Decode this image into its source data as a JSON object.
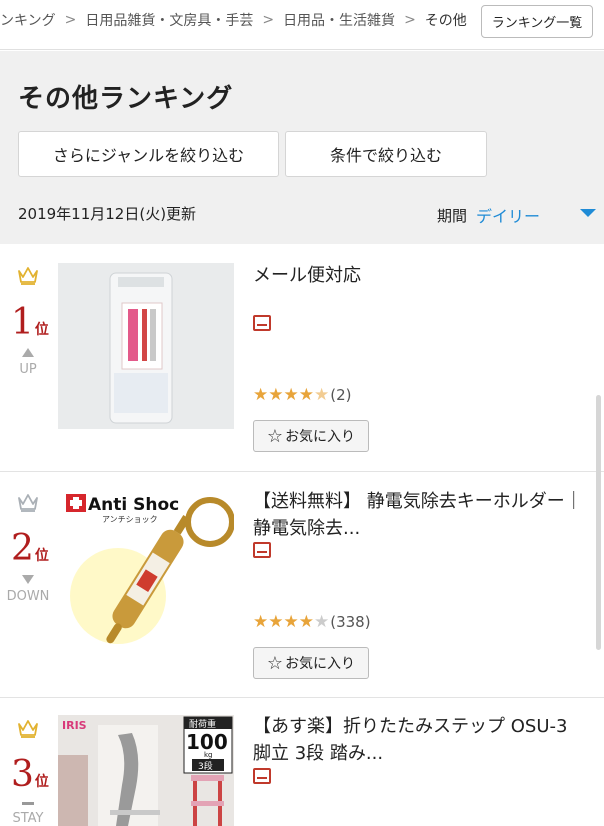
{
  "breadcrumb": {
    "items": [
      "ンキング",
      "日用品雑貨・文房具・手芸",
      "日用品・生活雑貨",
      "その他"
    ],
    "separator": ">"
  },
  "header": {
    "ranking_list_button": "ランキング一覧",
    "title": "その他ランキング",
    "genre_filter_button": "さらにジャンルを絞り込む",
    "condition_filter_button": "条件で絞り込む",
    "updated": "2019年11月12日(火)更新",
    "period_label": "期間",
    "period_value": "デイリー"
  },
  "colors": {
    "accent": "#1f8bd6",
    "rank": "#b01e1e",
    "star": "#e8a43a",
    "shop": "#c0392b"
  },
  "items": [
    {
      "rank": "1",
      "rank_unit": "位",
      "trend": "UP",
      "trend_icon": "up-arrow-icon",
      "name": "メール便対応",
      "stars": "★★★★",
      "half_star": "★",
      "empty_stars": "",
      "review_count": "(2)",
      "favorite_label": "お気に入り",
      "crown": "gold-crown-icon",
      "image": "clear-liquid-packet-image"
    },
    {
      "rank": "2",
      "rank_unit": "位",
      "trend": "DOWN",
      "trend_icon": "down-arrow-icon",
      "name": "【送料無料】 静電気除去キーホルダー｜静電気除去...",
      "stars": "★★★★",
      "half_star": "",
      "empty_stars": "★",
      "review_count": "(338)",
      "favorite_label": "お気に入り",
      "crown": "silver-crown-icon",
      "image": "anti-shock-keyholder-image",
      "image_text": {
        "brand": "Anti Shoc",
        "sub": "アンチショック"
      }
    },
    {
      "rank": "3",
      "rank_unit": "位",
      "trend": "STAY",
      "trend_icon": "dash-icon",
      "name": "【あす楽】折りたたみステップ OSU-3脚立 3段 踏み...",
      "crown": "gold-crown-icon",
      "image": "folding-step-ladder-image",
      "image_text": {
        "brand": "IRIS",
        "badge_top": "耐荷重",
        "badge_num": "100",
        "badge_unit": "kg",
        "badge_steps": "3段"
      }
    }
  ]
}
